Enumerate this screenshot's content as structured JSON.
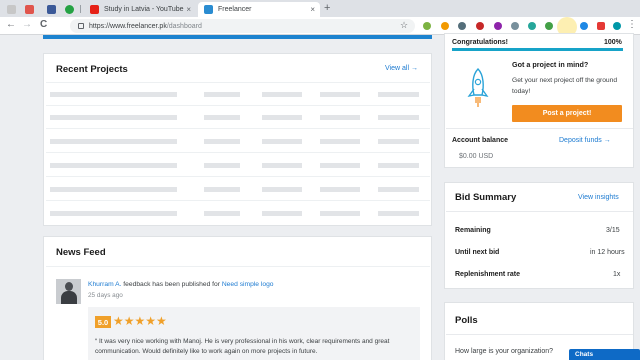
{
  "browser": {
    "tabs": [
      {
        "title": "Study in Latvia - YouTube",
        "favicon_color": "#e62117"
      },
      {
        "title": "Freelancer",
        "favicon_color": "#2a8cd1"
      }
    ],
    "close_glyph": "×",
    "new_tab_glyph": "+",
    "nav": {
      "back": "←",
      "forward": "→",
      "reload": "C"
    },
    "url_host": "https://www.freelancer.pk",
    "url_path": "/dashboard",
    "star": "☆",
    "menu": "⋮"
  },
  "recent_projects": {
    "title": "Recent Projects",
    "view_all": "View all →"
  },
  "news_feed": {
    "title": "News Feed",
    "author": "Khurram A.",
    "message": " feedback has been published for ",
    "project": "Need simple logo",
    "time_ago": "25 days ago",
    "rating": "5.0",
    "stars": "★★★★★",
    "review_text": "“ It was very nice working with Manoj. He is very professional in his work, clear requirements and great communication. Would definitely like to work again on more projects in future."
  },
  "profile": {
    "congrats": "Congratulations!",
    "percent_label": "100%",
    "progress_value": 1.0,
    "cta_title": "Got a project in mind?",
    "cta_text": "Get your next project off the ground today!",
    "post_button": "Post a project!",
    "account_balance_label": "Account balance",
    "deposit_link": "Deposit funds →",
    "balance": "$0.00 USD"
  },
  "bid_summary": {
    "title": "Bid Summary",
    "view_insights": "View insights",
    "rows": [
      {
        "label": "Remaining",
        "value": "3/15"
      },
      {
        "label": "Until next bid",
        "value": "in 12 hours"
      },
      {
        "label": "Replenishment rate",
        "value": "1x"
      }
    ]
  },
  "polls": {
    "title": "Polls",
    "question": "How large is your organization?"
  },
  "chat": {
    "label": "Chats"
  },
  "colors": {
    "accent": "#1d7bd1",
    "brand_blue": "#1d83cf",
    "orange": "#f28c1f",
    "progress": "#17a3c8"
  }
}
